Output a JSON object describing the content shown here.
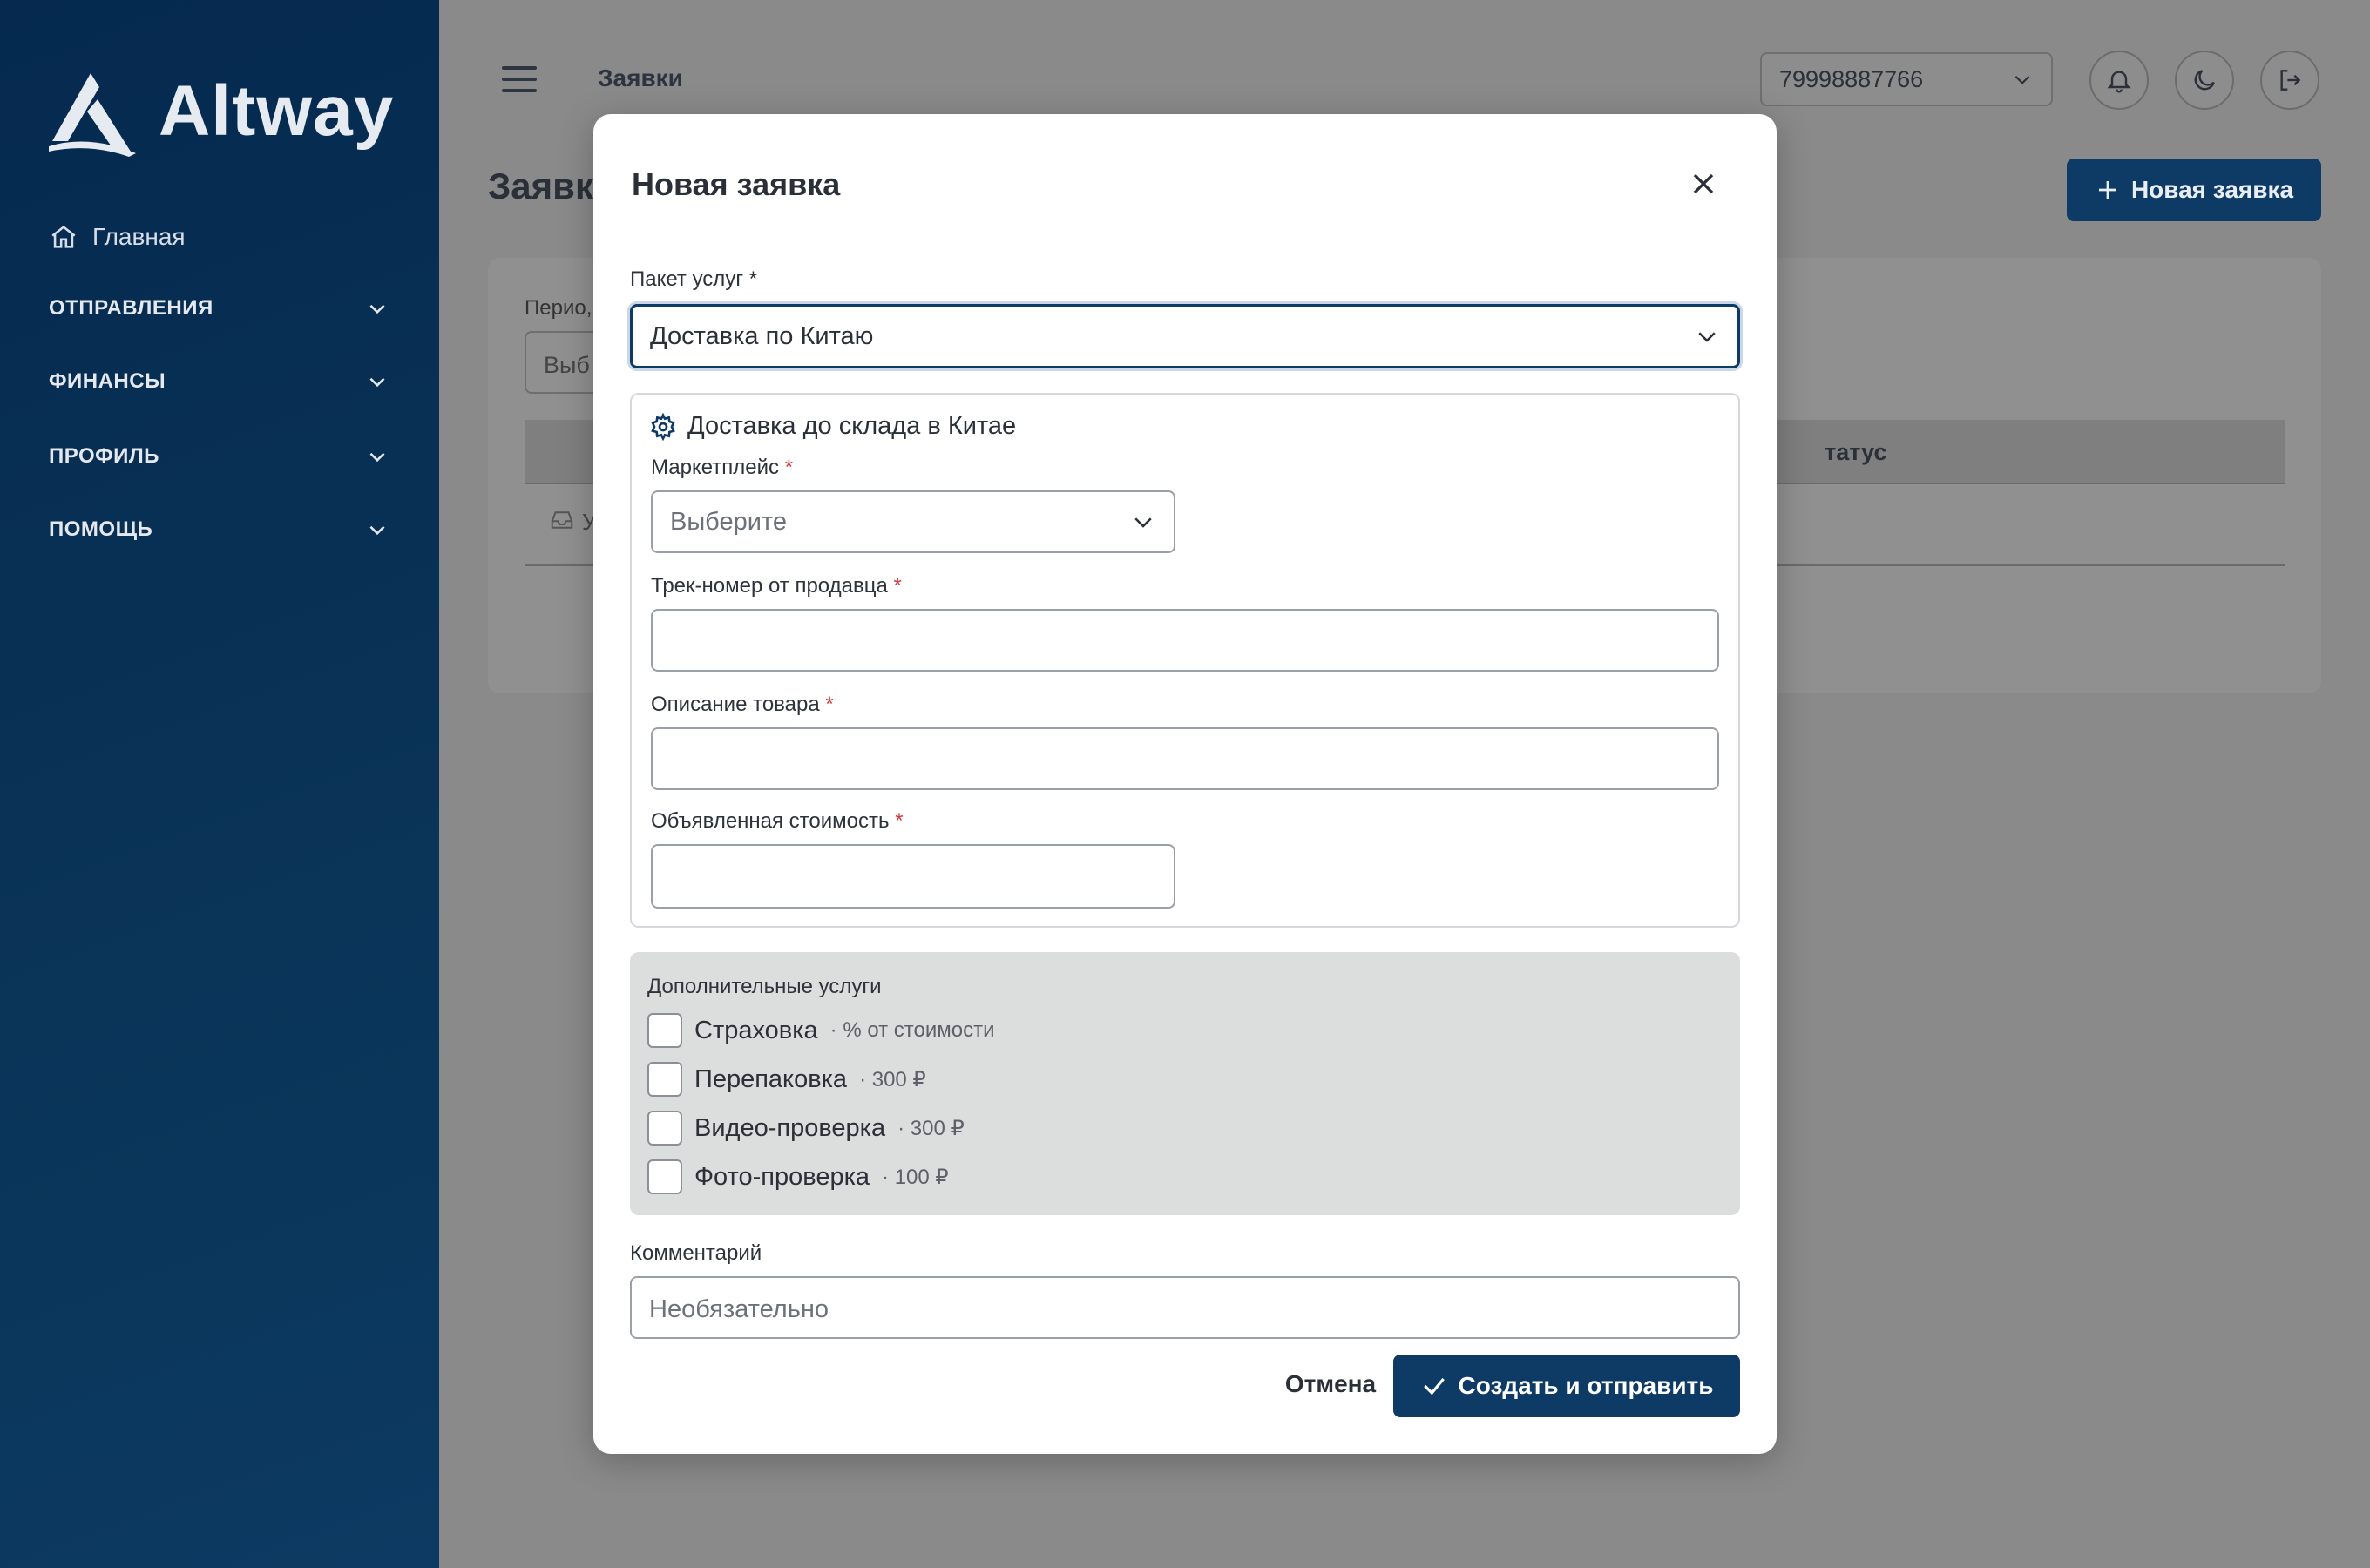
{
  "app": {
    "logo_text": "Altway"
  },
  "sidebar": {
    "home_label": "Главная",
    "groups": [
      {
        "label": "ОТПРАВЛЕНИЯ"
      },
      {
        "label": "ФИНАНСЫ"
      },
      {
        "label": "ПРОФИЛЬ"
      },
      {
        "label": "ПОМОЩЬ"
      }
    ]
  },
  "header": {
    "breadcrumb": "Заявки",
    "account_phone": "79998887766"
  },
  "page": {
    "title": "Заявк",
    "new_button_label": "Новая заявка",
    "period_label": "Перио,",
    "period_input_value": "Выб",
    "status_column": "татус",
    "row_text": "У"
  },
  "modal": {
    "title": "Новая заявка",
    "package_label": "Пакет услуг *",
    "package_value": "Доставка по Китаю",
    "section_title": "Доставка до склада в Китае",
    "marketplace_label": "Маркетплейс",
    "marketplace_placeholder": "Выберите",
    "track_label": "Трек-номер от продавца",
    "description_label": "Описание товара",
    "declared_value_label": "Объявленная стоимость",
    "required_mark": "*",
    "extras_title": "Дополнительные услуги",
    "extras": [
      {
        "label": "Страховка",
        "price": "· % от стоимости"
      },
      {
        "label": "Перепаковка",
        "price": "· 300 ₽"
      },
      {
        "label": "Видео-проверка",
        "price": "· 300 ₽"
      },
      {
        "label": "Фото-проверка",
        "price": "· 100 ₽"
      }
    ],
    "comment_label": "Комментарий",
    "comment_placeholder": "Необязательно",
    "cancel_label": "Отмена",
    "submit_label": "Создать и отправить"
  },
  "colors": {
    "sidebar_bg": "#05294f",
    "primary": "#0e3a66",
    "overlay_bg": "#8a8a8a",
    "required": "#d23a3a"
  },
  "icons": [
    "logo-mark-icon",
    "home-icon",
    "chevron-down-icon",
    "menu-icon",
    "bell-icon",
    "moon-icon",
    "logout-icon",
    "plus-icon",
    "close-icon",
    "gear-icon",
    "inbox-icon",
    "check-icon"
  ]
}
